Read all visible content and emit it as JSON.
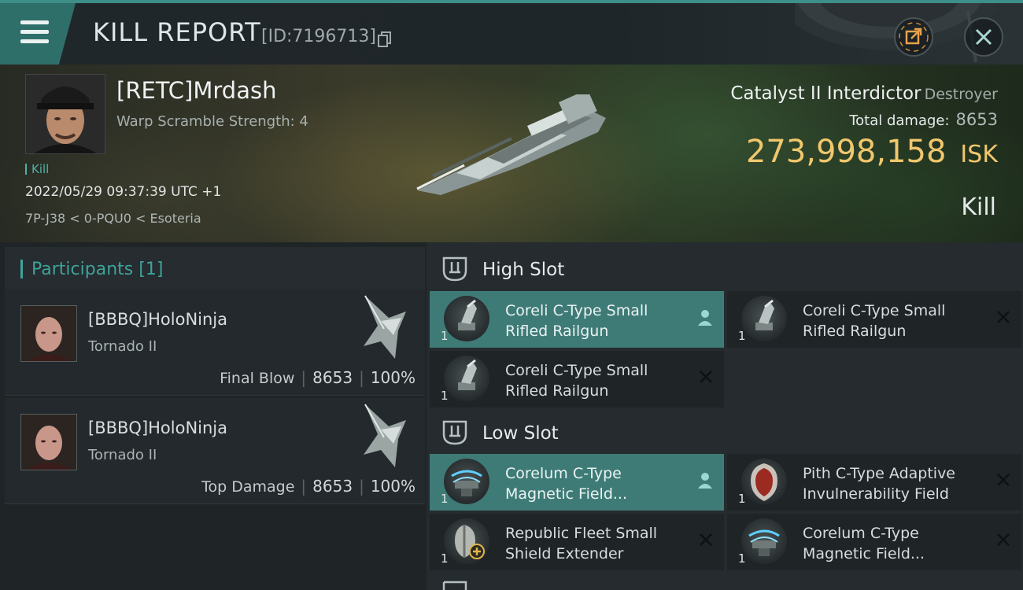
{
  "header": {
    "title": "KILL REPORT",
    "report_id": "[ID:7196713]",
    "icons": [
      "menu-icon",
      "copy-icon",
      "share-icon",
      "close-icon"
    ]
  },
  "victim": {
    "name": "[RETC]Mrdash",
    "subtitle": "Warp Scramble Strength: 4",
    "tag": "Kill",
    "datetime": "2022/05/29 09:37:39 UTC +1",
    "location": "7P-J38 < 0-PQU0 < Esoteria"
  },
  "ship": {
    "name": "Catalyst II Interdictor",
    "class": "Destroyer",
    "total_damage_label": "Total damage:",
    "total_damage": "8653",
    "isk_value": "273,998,158",
    "isk_unit": "ISK",
    "result": "Kill"
  },
  "participants": {
    "header": "Participants",
    "count": "[1]",
    "items": [
      {
        "name": "[BBBQ]HoloNinja",
        "ship": "Tornado II",
        "role": "Final Blow",
        "damage": "8653",
        "percent": "100%"
      },
      {
        "name": "[BBBQ]HoloNinja",
        "ship": "Tornado II",
        "role": "Top Damage",
        "damage": "8653",
        "percent": "100%"
      }
    ]
  },
  "slots": {
    "high": {
      "title": "High Slot",
      "modules": [
        {
          "line1": "Coreli C-Type Small",
          "line2": "Rifled Railgun",
          "qty": "1",
          "highlighted": true
        },
        {
          "line1": "Coreli C-Type Small",
          "line2": "Rifled Railgun",
          "qty": "1",
          "highlighted": false
        },
        {
          "line1": "Coreli C-Type Small",
          "line2": "Rifled Railgun",
          "qty": "1",
          "highlighted": false
        }
      ]
    },
    "low": {
      "title": "Low Slot",
      "modules": [
        {
          "line1": "Corelum C-Type",
          "line2": "Magnetic Field...",
          "qty": "1",
          "highlighted": true
        },
        {
          "line1": "Pith C-Type Adaptive",
          "line2": "Invulnerability Field",
          "qty": "1",
          "highlighted": false
        },
        {
          "line1": "Republic Fleet Small",
          "line2": "Shield Extender",
          "qty": "1",
          "highlighted": false
        },
        {
          "line1": "Corelum C-Type",
          "line2": "Magnetic Field...",
          "qty": "1",
          "highlighted": false
        }
      ]
    }
  },
  "colors": {
    "accent": "#3ea39a",
    "highlight_row": "#3e7b77",
    "isk": "#f1c76d"
  }
}
